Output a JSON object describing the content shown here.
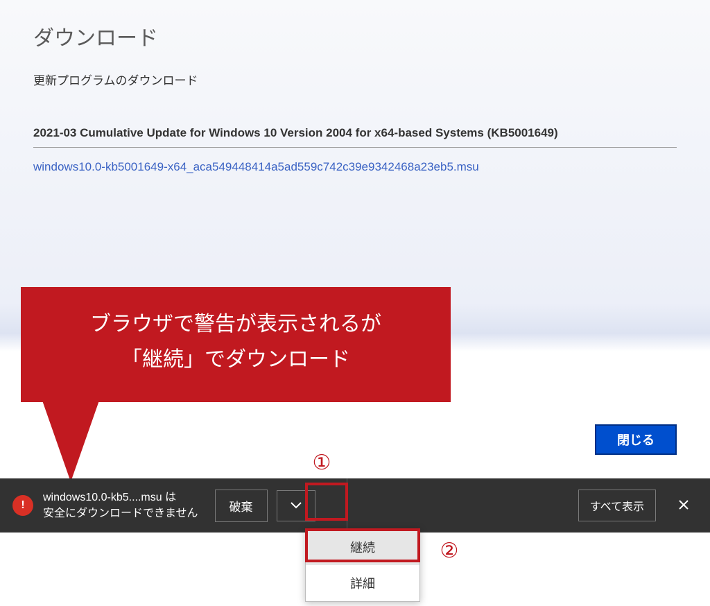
{
  "page": {
    "title": "ダウンロード",
    "subtitle": "更新プログラムのダウンロード",
    "update_title": "2021-03 Cumulative Update for Windows 10 Version 2004 for x64-based Systems (KB5001649)",
    "download_link": "windows10.0-kb5001649-x64_aca549448414a5ad559c742c39e9342468a23eb5.msu",
    "close_label": "閉じる"
  },
  "callout": {
    "line1": "ブラウザで警告が表示されるが",
    "line2": "「継続」でダウンロード"
  },
  "annotations": {
    "one": "①",
    "two": "②"
  },
  "download_bar": {
    "file_line1": "windows10.0-kb5....msu は",
    "file_line2": "安全にダウンロードできません",
    "discard_label": "破棄",
    "show_all_label": "すべて表示"
  },
  "dropdown": {
    "continue_label": "継続",
    "details_label": "詳細"
  }
}
